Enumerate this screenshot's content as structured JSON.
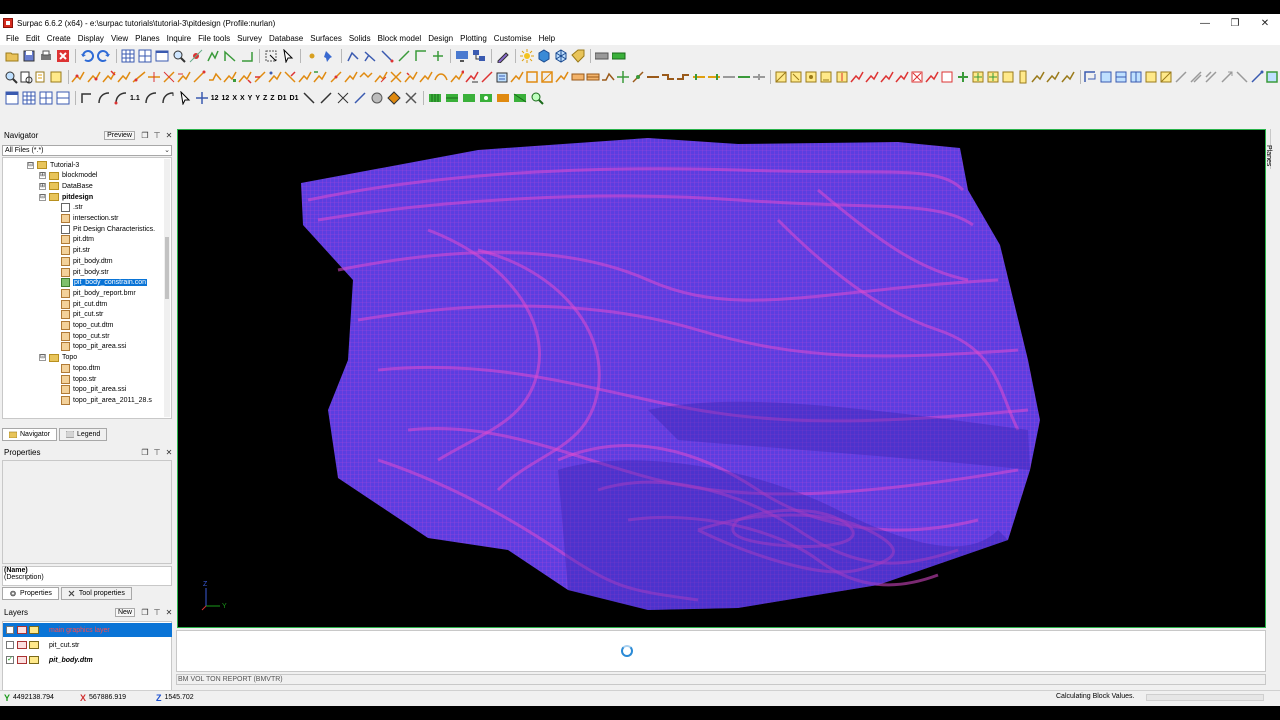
{
  "window": {
    "title": "Surpac 6.6.2 (x64) - e:\\surpac tutorials\\tutorial-3\\pitdesign (Profile:nurlan)",
    "minimize": "—",
    "maximize": "❐",
    "close": "✕"
  },
  "menu": [
    "File",
    "Edit",
    "Create",
    "Display",
    "View",
    "Planes",
    "Inquire",
    "File tools",
    "Survey",
    "Database",
    "Surfaces",
    "Solids",
    "Block model",
    "Design",
    "Plotting",
    "Customise",
    "Help"
  ],
  "toolbar_text": {
    "t1": "1.1",
    "t2": "12",
    "t3": "12",
    "t4": "X",
    "t5": "X",
    "t6": "Y",
    "t7": "Y",
    "t8": "Z",
    "t9": "Z",
    "t10": "D1",
    "t11": "D1"
  },
  "navigator": {
    "title": "Navigator",
    "preview": "Preview",
    "filter": "All Files (*.*)",
    "items": [
      {
        "label": "Tutorial-3",
        "level": 1,
        "type": "folder",
        "exp": "⊟"
      },
      {
        "label": "blockmodel",
        "level": 2,
        "type": "folder",
        "exp": "⊞"
      },
      {
        "label": "DataBase",
        "level": 2,
        "type": "folder",
        "exp": "⊞"
      },
      {
        "label": "pitdesign",
        "level": 2,
        "type": "folder",
        "exp": "⊟",
        "bold": true
      },
      {
        "label": ".str",
        "level": 3,
        "type": "file-blank"
      },
      {
        "label": "intersection.str",
        "level": 3,
        "type": "file"
      },
      {
        "label": "Pit Design Characteristics.",
        "level": 3,
        "type": "file-blank"
      },
      {
        "label": "pit.dtm",
        "level": 3,
        "type": "file"
      },
      {
        "label": "pit.str",
        "level": 3,
        "type": "file"
      },
      {
        "label": "pit_body.dtm",
        "level": 3,
        "type": "file"
      },
      {
        "label": "pit_body.str",
        "level": 3,
        "type": "file"
      },
      {
        "label": "pit_body_constrain.con",
        "level": 3,
        "type": "file-green",
        "selected": true
      },
      {
        "label": "pit_body_report.bmr",
        "level": 3,
        "type": "file"
      },
      {
        "label": "pit_cut.dtm",
        "level": 3,
        "type": "file"
      },
      {
        "label": "pit_cut.str",
        "level": 3,
        "type": "file"
      },
      {
        "label": "topo_cut.dtm",
        "level": 3,
        "type": "file"
      },
      {
        "label": "topo_cut.str",
        "level": 3,
        "type": "file"
      },
      {
        "label": "topo_pit_area.ssi",
        "level": 3,
        "type": "file"
      },
      {
        "label": "Topo",
        "level": 2,
        "type": "folder",
        "exp": "⊟"
      },
      {
        "label": "topo.dtm",
        "level": 3,
        "type": "file"
      },
      {
        "label": "topo.str",
        "level": 3,
        "type": "file"
      },
      {
        "label": "topo_pit_area.ssi",
        "level": 3,
        "type": "file"
      },
      {
        "label": "topo_pit_area_2011_28.s",
        "level": 3,
        "type": "file"
      }
    ],
    "tab_navigator": "Navigator",
    "tab_legend": "Legend"
  },
  "properties": {
    "title": "Properties",
    "name": "(Name)",
    "description": "(Description)",
    "tab_properties": "Properties",
    "tab_tool_properties": "Tool properties"
  },
  "layers": {
    "title": "Layers",
    "new": "New",
    "items": [
      {
        "label": "main graphics layer",
        "selected": true,
        "checked": false
      },
      {
        "label": "pit_cut.str",
        "selected": false,
        "checked": false
      },
      {
        "label": "pit_body.dtm",
        "selected": false,
        "checked": true,
        "bolditalic": true
      }
    ]
  },
  "viewport": {
    "axis_z": "Z",
    "axis_y": "Y",
    "right_tab": "Planes",
    "colors": {
      "surface": "#5b3ee0",
      "grid": "#e04ad0",
      "background": "#000000",
      "border": "#29b34a"
    }
  },
  "console": {
    "input_text": "BM VOL TON REPORT (BMVTR)"
  },
  "status": {
    "y": "4492138.794",
    "x": "567886.919",
    "z": "1545.702",
    "message": "Calculating Block Values."
  }
}
